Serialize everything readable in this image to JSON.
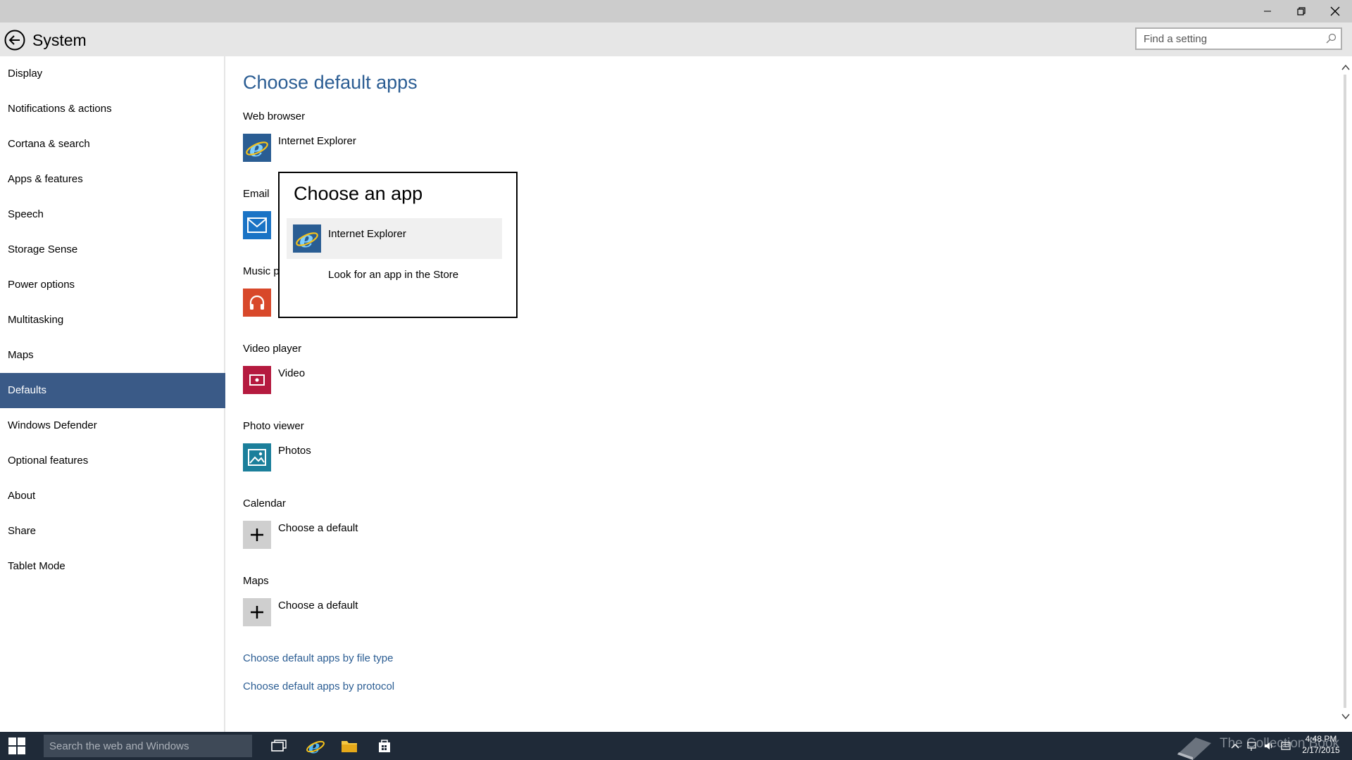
{
  "window": {
    "minimize_label": "minimize",
    "restore_label": "restore",
    "close_label": "close"
  },
  "header": {
    "title": "System",
    "search_placeholder": "Find a setting"
  },
  "sidebar": {
    "items": [
      {
        "label": "Display"
      },
      {
        "label": "Notifications & actions"
      },
      {
        "label": "Cortana & search"
      },
      {
        "label": "Apps & features"
      },
      {
        "label": "Speech"
      },
      {
        "label": "Storage Sense"
      },
      {
        "label": "Power options"
      },
      {
        "label": "Multitasking"
      },
      {
        "label": "Maps"
      },
      {
        "label": "Defaults"
      },
      {
        "label": "Windows Defender"
      },
      {
        "label": "Optional features"
      },
      {
        "label": "About"
      },
      {
        "label": "Share"
      },
      {
        "label": "Tablet Mode"
      }
    ],
    "active": "Defaults"
  },
  "main": {
    "title": "Choose default apps",
    "sections": [
      {
        "category": "Web browser",
        "app": "Internet Explorer",
        "icon": "internet-explorer-icon",
        "color": "#2a5d93"
      },
      {
        "category": "Email",
        "app": "",
        "icon": "mail-icon",
        "color": "#1a73c5"
      },
      {
        "category": "Music p",
        "app": "",
        "icon": "headphones-icon",
        "color": "#d8482a"
      },
      {
        "category": "Video player",
        "app": "Video",
        "icon": "video-icon",
        "color": "#b51a3f"
      },
      {
        "category": "Photo viewer",
        "app": "Photos",
        "icon": "photos-icon",
        "color": "#1b7f9b"
      },
      {
        "category": "Calendar",
        "app": "Choose a default",
        "icon": "plus-icon",
        "color": "#cfcfcf"
      },
      {
        "category": "Maps",
        "app": "Choose a default",
        "icon": "plus-icon",
        "color": "#cfcfcf"
      }
    ],
    "links": [
      "Choose default apps by file type",
      "Choose default apps by protocol"
    ]
  },
  "flyout": {
    "title": "Choose an app",
    "options": [
      {
        "label": "Internet Explorer",
        "icon": "internet-explorer-icon"
      },
      {
        "label": "Look for an app in the Store"
      }
    ]
  },
  "taskbar": {
    "search_placeholder": "Search the web and Windows",
    "watermark": "The Collection Book",
    "time": "4:48 PM",
    "date": "2/17/2015"
  }
}
